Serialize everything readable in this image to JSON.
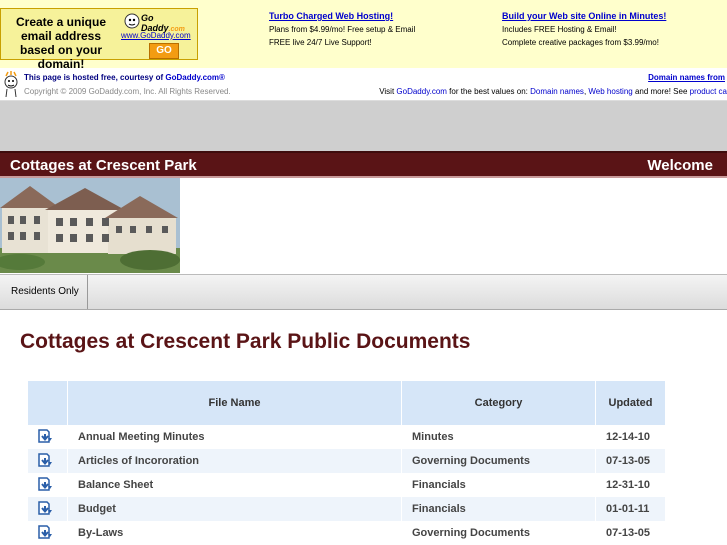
{
  "ad": {
    "box_text": "Create a unique email address based on your domain!",
    "logo": "Go Daddy",
    "logo_sub": ".com",
    "url": "www.GoDaddy.com",
    "go": "GO",
    "col1": {
      "heading": "Turbo Charged Web Hosting!",
      "line1": "Plans from $4.99/mo! Free setup & Email",
      "line2": "FREE live 24/7 Live Support!"
    },
    "col2": {
      "heading": "Build your Web site Online in Minutes!",
      "line1": "Includes FREE Hosting & Email!",
      "line2": "Complete creative packages from $3.99/mo!"
    }
  },
  "hosting": {
    "line1_prefix": "This page is hosted free, courtesy of ",
    "line1_link": "GoDaddy.com®",
    "copyright": "Copyright © 2009 GoDaddy.com, Inc. All Rights Reserved.",
    "right_link": "Domain names from",
    "right_text_prefix": "Visit ",
    "right_link2": "GoDaddy.com",
    "right_text_mid": " for the best values on: ",
    "right_link3": "Domain names",
    "right_sep": ", ",
    "right_link4": "Web hosting",
    "right_text_end": " and more! See ",
    "right_link5": "product ca"
  },
  "site": {
    "title": "Cottages at Crescent Park",
    "welcome": "Welcome"
  },
  "nav": {
    "items": [
      {
        "label": "Residents Only"
      }
    ]
  },
  "page": {
    "title": "Cottages at Crescent Park Public Documents"
  },
  "table": {
    "headers": {
      "file": "File Name",
      "category": "Category",
      "updated": "Updated"
    },
    "rows": [
      {
        "name": "Annual Meeting Minutes",
        "category": "Minutes",
        "updated": "12-14-10"
      },
      {
        "name": "Articles of Incororation",
        "category": "Governing Documents",
        "updated": "07-13-05"
      },
      {
        "name": "Balance Sheet",
        "category": "Financials",
        "updated": "12-31-10"
      },
      {
        "name": "Budget",
        "category": "Financials",
        "updated": "01-01-11"
      },
      {
        "name": "By-Laws",
        "category": "Governing Documents",
        "updated": "07-13-05"
      }
    ]
  },
  "colors": {
    "brand_maroon": "#5a1416",
    "table_header": "#d6e6f8",
    "ad_bg": "#ffffcc"
  },
  "icons": {
    "row_icon": "download-document-icon"
  }
}
